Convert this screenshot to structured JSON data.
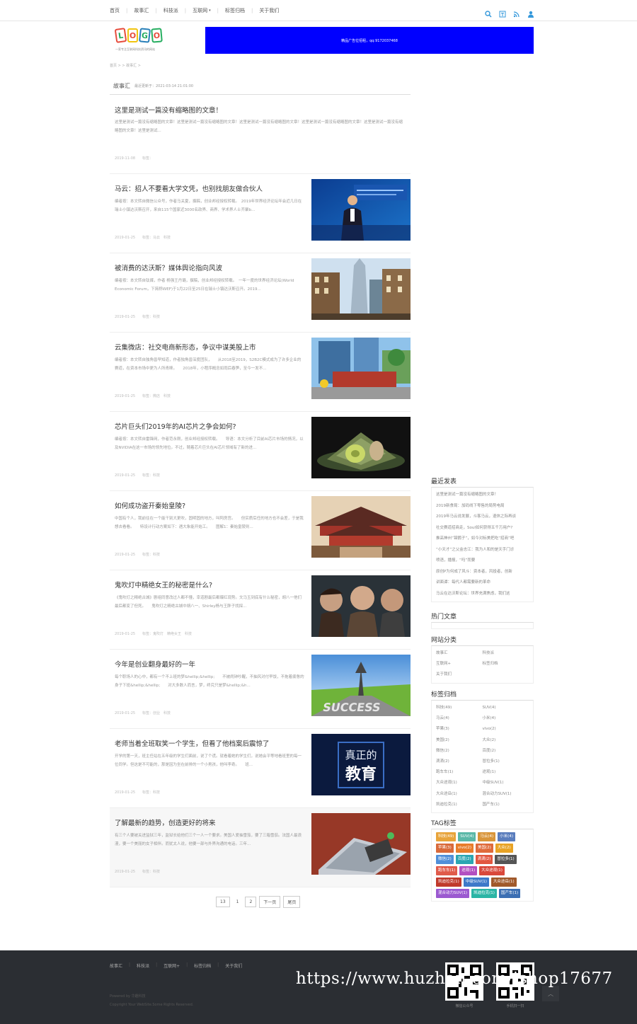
{
  "nav": {
    "items": [
      "首页",
      "故事汇",
      "科技派",
      "互联网",
      "标签归档",
      "关于我们"
    ],
    "dropdown_marker": "▾"
  },
  "logo": {
    "letters": [
      "L",
      "O",
      "G",
      "O"
    ],
    "tagline": "一家专注互联网科技资讯的网站"
  },
  "banner": {
    "text": "精品广告位招租，qq:9172037468"
  },
  "breadcrumb": "首页 > > 故事汇 >",
  "category": {
    "name": "故事汇",
    "updated": "最近更新于：2021-03-14 21:01:00"
  },
  "articles": [
    {
      "title": "这里是测试一篇没有缩略图的文章！",
      "excerpt": "这里是测试一篇没有缩略图的文章！这里是测试一篇没有缩略图的文章！这里是测试一篇没有缩略图的文章！这里是测试一篇没有缩略图的文章！这里是测试一篇没有缩略图的文章！这里是测试...",
      "meta": "2019-11-08　　标签："
    },
    {
      "title": "马云：招人不要看大学文凭，也别找朋友做合伙人",
      "excerpt": "编者按：本文转自微信公众号，作者马关夏，撰稿，创业邦经授权转载。　2019年世界经济论坛年会近几日在瑞士小镇达沃斯召开，来自115个国家近3000名政界、商界、学术界人士齐聚b...",
      "meta": "2019-01-25　　标签：马云　科技"
    },
    {
      "title": "被消费的达沃斯？媒体舆论指向风波",
      "excerpt": "编者按：本文转自钛媒，作者 杨强王丹璐，撰稿，创业邦经授权转载。　一年一度的世界经济论坛(World Economic Forum，下简称WEF)于1月22日至25日在瑞士小镇达沃斯召开。2019...",
      "meta": "2019-01-25　　标签：科技"
    },
    {
      "title": "云集微店：社交电商新形态，争议中谋美股上市",
      "excerpt": "编者按：本文转自独角兽早知道，作者独角兽深度团队，　　从2018至2019，S2B2C模式成为了许多企业的赛道，在资本市场中更为人所青睐。　　2018年，小程序概念如雨后春笋，至今一发不...",
      "meta": "2019-01-25　　标签：微店　科技"
    },
    {
      "title": "芯片巨头们2019年的AI芯片之争会如何?",
      "excerpt": "编者按：本文转自雷锋网，作者范永刚，创业邦经授权转载。　　导语：本文分析了目前AI芯片市场的情况，以及NVIDIA在这一市场的领先地位。不过，随着芯片巨头在AI芯片领域有了新的进...",
      "meta": "2019-01-25　　标签：科技"
    },
    {
      "title": "如何成功盗开秦始皇陵?",
      "excerpt": "中国有个人，我前往在一个能干别大更吹，固明固的地方，叫阿房宫。　　但实质后任的地方也不会差，于是我想去看看。　　特设计行动方案如下：遇大象能开始工。　　图解1：秦始皇陵则...",
      "meta": "2019-01-25　　标签：科技"
    },
    {
      "title": "鬼吹灯中精绝女王的秘密是什么?",
      "excerpt": "《鬼吹灯之精绝古城》剧组同意改过人都不懂，幸道剧最后都爆红现势。文马玉到底有什么秘密，胡八一他们最后都变了但死。　　鬼吹灯之精绝古城中胡八一、Shirley杨与王胖子找探...",
      "meta": "2019-01-25　　标签：鬼吹灯　精绝女王　科技"
    },
    {
      "title": "今年是创业翻身最好的一年",
      "excerpt": "每个职场人的心中，都有一个不上班的梦&hellip;&hellip;　　不被闹钟吵醒，不抽风对付早饭，不拖着疲惫的身子下班&hellip;&hellip;　　对大多数人而言，梦，终究只是梦&hellip;&h...",
      "meta": "2019-01-25　　标签：创业　科技"
    },
    {
      "title": "老师当着全班取笑一个学生，但看了他档案后震惊了",
      "excerpt": "开学的第一天，班主任站在五年级的学生们面前，说了个谎。就看着她的学生们，说她会平等地看班里的每一位同学。但这是不可能的，那是因为坐在前排的一个小男孩，他叫李奇。　　班...",
      "meta": "2019-01-25　　标签：科技"
    },
    {
      "title": "了解最新的趋势，创造更好的将来",
      "excerpt": "有三个人要被关进监狱三年，监狱长给他们三个一人一个要求。美国人爱抽雪茄，要了三箱雪茄。法国人最浪漫，要一个美丽的女子相伴。而犹太人说，他要一部与外界沟通的电话。三年...",
      "meta": "2019-01-25　　标签：科技"
    }
  ],
  "pagination": {
    "total": "13",
    "current": "1",
    "next_num": "2",
    "next": "下一页",
    "last": "尾页"
  },
  "sidebar": {
    "recent_title": "最近发表",
    "recent": [
      "这里是测试一篇没有缩略图的文章！",
      "2019新食局：加码线下零售的局势电局",
      "2019年马云说发展，斗客马云，退休之际再谈",
      "社交赛道招商走，Soul如何获得五千万用户?",
      "推高神州“锦鹦子”，如今对标美把吃“招商”吧",
      "“小天才”之父金志江：我为人和的是天手门诊",
      "喷语，播报，“吗”而要",
      "原创P为何成了风斗：资本者，风投者，创新",
      "讲面谭：每代人都需要新的革命",
      "马云在达沃斯论坛：世界充满焦虑，我们这"
    ],
    "hot_title": "热门文章",
    "cats_title": "网站分类",
    "cats": [
      "故事汇",
      "科技派",
      "互联网+",
      "标签归档",
      "关于我们"
    ],
    "archive_title": "标签归档",
    "archive": [
      "科技(49)",
      "SUV(4)",
      "马云(4)",
      "小米(4)",
      "苹果(3)",
      "vivo(2)",
      "美国(2)",
      "大众(2)",
      "微信(2)",
      "百度(2)",
      "滴滴(2)",
      "冒拉多(1)",
      "跑车车(1)",
      "途观(1)",
      "大众途观(1)",
      "中级SUV(1)",
      "大众途岳(1)",
      "混合动力SUV(1)",
      "凯迪拉克(1)",
      "国产车(1)"
    ],
    "tag_title": "TAG标签",
    "tags": [
      {
        "t": "科技(49)",
        "c": "#e8a43a"
      },
      {
        "t": "SUV(4)",
        "c": "#5bb8a8"
      },
      {
        "t": "马云(4)",
        "c": "#d9953a"
      },
      {
        "t": "小米(4)",
        "c": "#5a7dbd"
      },
      {
        "t": "苹果(3)",
        "c": "#d96a3a"
      },
      {
        "t": "vivo(2)",
        "c": "#e87d2b"
      },
      {
        "t": "美国(2)",
        "c": "#df6b3b"
      },
      {
        "t": "大众(2)",
        "c": "#e8a325"
      },
      {
        "t": "微信(2)",
        "c": "#4f8fd9"
      },
      {
        "t": "百度(2)",
        "c": "#2ba6b2"
      },
      {
        "t": "滴滴(2)",
        "c": "#e25740"
      },
      {
        "t": "冒拉多(1)",
        "c": "#555555"
      },
      {
        "t": "跑车车(1)",
        "c": "#e05a4a"
      },
      {
        "t": "途观(1)",
        "c": "#b34fc1"
      },
      {
        "t": "大众途观(1)",
        "c": "#d9483b"
      },
      {
        "t": "凯迪拉克(1)",
        "c": "#c0392b"
      },
      {
        "t": "中级SUV(1)",
        "c": "#3d79c9"
      },
      {
        "t": "大众途岳(1)",
        "c": "#a0592b"
      },
      {
        "t": "混合动力SUV(1)",
        "c": "#9b59d0"
      },
      {
        "t": "凯迪拉克(1)",
        "c": "#2ab5a5"
      },
      {
        "t": "国产车(1)",
        "c": "#3c6fb3"
      }
    ]
  },
  "footer": {
    "nav": [
      "故事汇",
      "科技派",
      "互联网+",
      "标签归档",
      "关于我们"
    ],
    "powered": "Powered by 华趣科技",
    "copyright": "Copyright Your WebSite.Some Rights Reserved.",
    "qr1": "微信公众号",
    "qr2": "手机扫一扫",
    "totop": "︿"
  },
  "watermark": "https://www.huzhan.com/ishop17677",
  "colors": {
    "banner": "#0000ff",
    "footer_bg": "#2b2e33",
    "icon": "#3498db"
  }
}
